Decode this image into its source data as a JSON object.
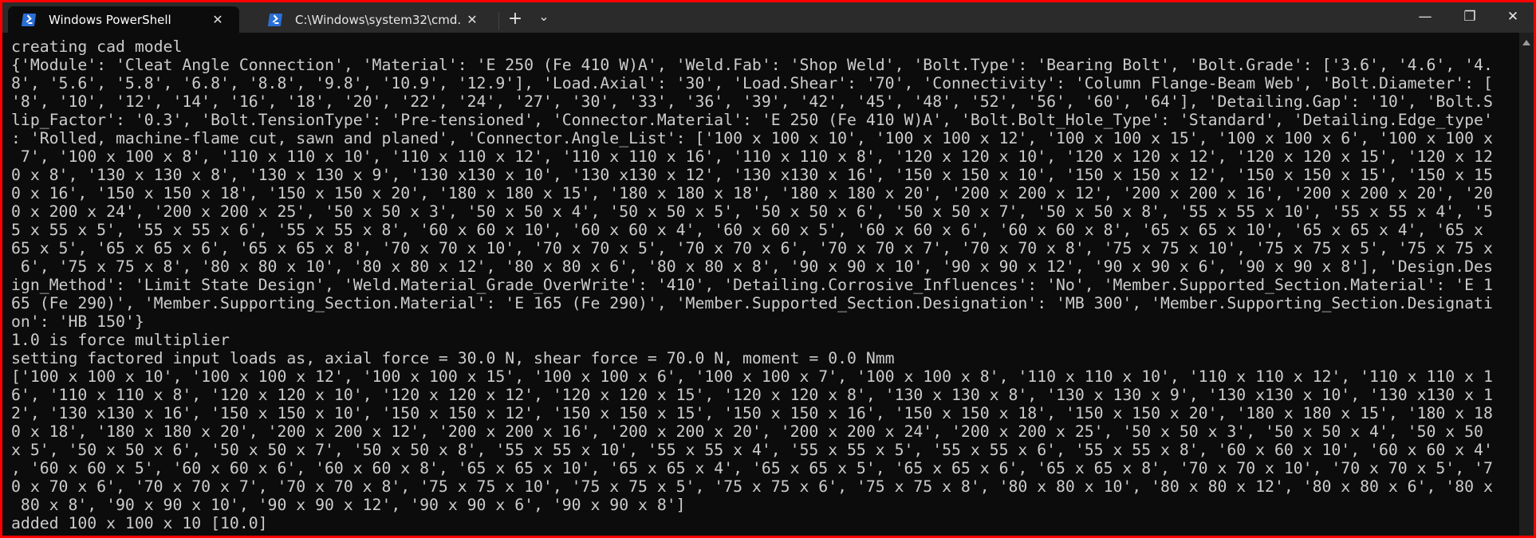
{
  "tabs": [
    {
      "title": "Windows PowerShell",
      "icon": "powershell-icon",
      "active": true,
      "close": "✕"
    },
    {
      "title": "C:\\Windows\\system32\\cmd.exe",
      "icon": "powershell-icon",
      "active": false,
      "close": "✕"
    }
  ],
  "toolbar": {
    "new_tab": "+",
    "dropdown": "⌄"
  },
  "window_controls": {
    "minimize": "—",
    "restore": "❐",
    "close": "✕"
  },
  "colors": {
    "border": "#ff0000",
    "terminal_bg": "#0c0c0c",
    "text": "#cccccc",
    "titlebar": "#2b2b2b",
    "icon": "#2a6fd6"
  },
  "terminal": {
    "lines": [
      "creating cad model",
      "{'Module': 'Cleat Angle Connection', 'Material': 'E 250 (Fe 410 W)A', 'Weld.Fab': 'Shop Weld', 'Bolt.Type': 'Bearing Bolt', 'Bolt.Grade': ['3.6', '4.6', '4.",
      "8', '5.6', '5.8', '6.8', '8.8', '9.8', '10.9', '12.9'], 'Load.Axial': '30', 'Load.Shear': '70', 'Connectivity': 'Column Flange-Beam Web', 'Bolt.Diameter': [",
      "'8', '10', '12', '14', '16', '18', '20', '22', '24', '27', '30', '33', '36', '39', '42', '45', '48', '52', '56', '60', '64'], 'Detailing.Gap': '10', 'Bolt.S",
      "lip_Factor': '0.3', 'Bolt.TensionType': 'Pre-tensioned', 'Connector.Material': 'E 250 (Fe 410 W)A', 'Bolt.Bolt_Hole_Type': 'Standard', 'Detailing.Edge_type'",
      ": 'Rolled, machine-flame cut, sawn and planed', 'Connector.Angle_List': ['100 x 100 x 10', '100 x 100 x 12', '100 x 100 x 15', '100 x 100 x 6', '100 x 100 x",
      " 7', '100 x 100 x 8', '110 x 110 x 10', '110 x 110 x 12', '110 x 110 x 16', '110 x 110 x 8', '120 x 120 x 10', '120 x 120 x 12', '120 x 120 x 15', '120 x 12",
      "0 x 8', '130 x 130 x 8', '130 x 130 x 9', '130 x130 x 10', '130 x130 x 12', '130 x130 x 16', '150 x 150 x 10', '150 x 150 x 12', '150 x 150 x 15', '150 x 15",
      "0 x 16', '150 x 150 x 18', '150 x 150 x 20', '180 x 180 x 15', '180 x 180 x 18', '180 x 180 x 20', '200 x 200 x 12', '200 x 200 x 16', '200 x 200 x 20', '20",
      "0 x 200 x 24', '200 x 200 x 25', '50 x 50 x 3', '50 x 50 x 4', '50 x 50 x 5', '50 x 50 x 6', '50 x 50 x 7', '50 x 50 x 8', '55 x 55 x 10', '55 x 55 x 4', '5",
      "5 x 55 x 5', '55 x 55 x 6', '55 x 55 x 8', '60 x 60 x 10', '60 x 60 x 4', '60 x 60 x 5', '60 x 60 x 6', '60 x 60 x 8', '65 x 65 x 10', '65 x 65 x 4', '65 x",
      "65 x 5', '65 x 65 x 6', '65 x 65 x 8', '70 x 70 x 10', '70 x 70 x 5', '70 x 70 x 6', '70 x 70 x 7', '70 x 70 x 8', '75 x 75 x 10', '75 x 75 x 5', '75 x 75 x",
      " 6', '75 x 75 x 8', '80 x 80 x 10', '80 x 80 x 12', '80 x 80 x 6', '80 x 80 x 8', '90 x 90 x 10', '90 x 90 x 12', '90 x 90 x 6', '90 x 90 x 8'], 'Design.Des",
      "ign_Method': 'Limit State Design', 'Weld.Material_Grade_OverWrite': '410', 'Detailing.Corrosive_Influences': 'No', 'Member.Supported_Section.Material': 'E 1",
      "65 (Fe 290)', 'Member.Supporting_Section.Material': 'E 165 (Fe 290)', 'Member.Supported_Section.Designation': 'MB 300', 'Member.Supporting_Section.Designati",
      "on': 'HB 150'}",
      "1.0 is force multiplier",
      "setting factored input loads as, axial force = 30.0 N, shear force = 70.0 N, moment = 0.0 Nmm",
      "['100 x 100 x 10', '100 x 100 x 12', '100 x 100 x 15', '100 x 100 x 6', '100 x 100 x 7', '100 x 100 x 8', '110 x 110 x 10', '110 x 110 x 12', '110 x 110 x 1",
      "6', '110 x 110 x 8', '120 x 120 x 10', '120 x 120 x 12', '120 x 120 x 15', '120 x 120 x 8', '130 x 130 x 8', '130 x 130 x 9', '130 x130 x 10', '130 x130 x 1",
      "2', '130 x130 x 16', '150 x 150 x 10', '150 x 150 x 12', '150 x 150 x 15', '150 x 150 x 16', '150 x 150 x 18', '150 x 150 x 20', '180 x 180 x 15', '180 x 18",
      "0 x 18', '180 x 180 x 20', '200 x 200 x 12', '200 x 200 x 16', '200 x 200 x 20', '200 x 200 x 24', '200 x 200 x 25', '50 x 50 x 3', '50 x 50 x 4', '50 x 50",
      "x 5', '50 x 50 x 6', '50 x 50 x 7', '50 x 50 x 8', '55 x 55 x 10', '55 x 55 x 4', '55 x 55 x 5', '55 x 55 x 6', '55 x 55 x 8', '60 x 60 x 10', '60 x 60 x 4'",
      ", '60 x 60 x 5', '60 x 60 x 6', '60 x 60 x 8', '65 x 65 x 10', '65 x 65 x 4', '65 x 65 x 5', '65 x 65 x 6', '65 x 65 x 8', '70 x 70 x 10', '70 x 70 x 5', '7",
      "0 x 70 x 6', '70 x 70 x 7', '70 x 70 x 8', '75 x 75 x 10', '75 x 75 x 5', '75 x 75 x 6', '75 x 75 x 8', '80 x 80 x 10', '80 x 80 x 12', '80 x 80 x 6', '80 x",
      " 80 x 8', '90 x 90 x 10', '90 x 90 x 12', '90 x 90 x 6', '90 x 90 x 8']",
      "added 100 x 100 x 10 [10.0]"
    ]
  }
}
